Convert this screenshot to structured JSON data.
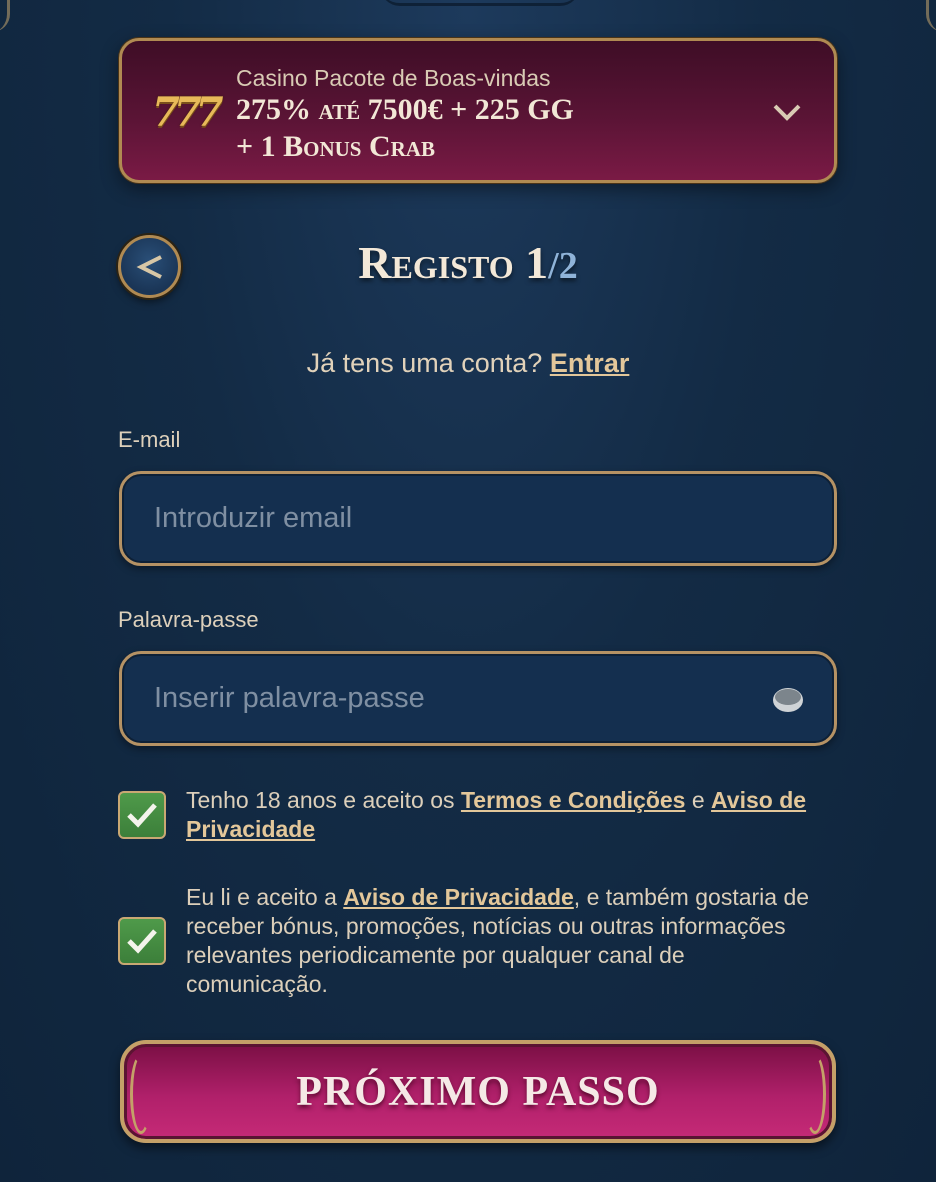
{
  "promo": {
    "icon_text": "777",
    "subtitle": "Casino Pacote de Boas-vindas",
    "title_line1": "275% até 7500€ + 225 GG",
    "title_line2": "+ 1 Bonus Crab"
  },
  "header": {
    "title": "Registo 1",
    "step_total": "/2"
  },
  "login": {
    "prompt": "Já tens uma conta?",
    "link": "Entrar"
  },
  "form": {
    "email_label": "E-mail",
    "email_placeholder": "Introduzir email",
    "email_value": "",
    "password_label": "Palavra-passe",
    "password_placeholder": "Inserir palavra-passe",
    "password_value": ""
  },
  "consent": {
    "terms_prefix": "Tenho 18 anos e aceito os",
    "terms_link": "Termos e Condições",
    "terms_and": "e",
    "terms_privacy_link": "Aviso de Privacidade",
    "marketing_prefix": "Eu li e aceito a",
    "marketing_link": "Aviso de Privacidade",
    "marketing_suffix": ", e também gostaria de receber bónus, promoções, notícias ou outras informações relevantes periodicamente por qualquer canal de comunicação."
  },
  "actions": {
    "next_label": "PRÓXIMO PASSO"
  },
  "colors": {
    "accent_gold": "#b08a52",
    "banner_magenta": "#5a1435",
    "check_green": "#4f9a4a",
    "button_pink": "#b0206a"
  }
}
